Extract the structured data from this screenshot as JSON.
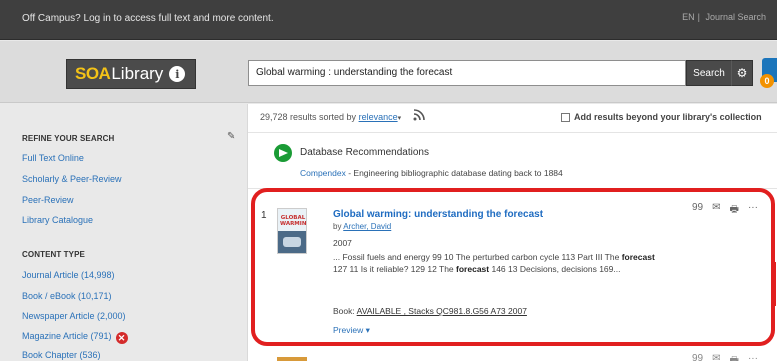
{
  "topbar": {
    "message": "Off Campus? Log in to access full text and more content.",
    "right_links": [
      "EN",
      "Journal Search"
    ]
  },
  "logo": {
    "part1": "SOA",
    "part2": "Library",
    "info_glyph": "i"
  },
  "search": {
    "value": "Global warming : understanding the forecast",
    "button_label": "Search",
    "gear_glyph": "⚙",
    "folder_count": "0"
  },
  "sidebar": {
    "refine_heading": "REFINE YOUR SEARCH",
    "refine_items": [
      "Full Text Online",
      "Scholarly & Peer-Review",
      "Peer-Review",
      "Library Catalogue"
    ],
    "content_type_heading": "CONTENT TYPE",
    "content_types": [
      "Journal Article (14,998)",
      "Book / eBook (10,171)",
      "Newspaper Article (2,000)",
      "Magazine Article (791)",
      "Book Chapter (536)"
    ]
  },
  "results_bar": {
    "summary_prefix": "29,728 results sorted by",
    "sort_label": "relevance",
    "add_beyond_label": "Add results beyond your library's collection"
  },
  "recommendations": {
    "title": "Database Recommendations",
    "database": "Compendex",
    "description": "- Engineering bibliographic database dating back to 1884"
  },
  "result": {
    "number": "1",
    "cover_text": "GLOBAL WARMING",
    "title": "Global warming: understanding the forecast",
    "author_prefix": "by",
    "author": "Archer, David",
    "year": "2007",
    "snippet": {
      "part1": "... Fossil fuels and energy 99 10 The perturbed carbon cycle 113 Part III The ",
      "bold1": "forecast",
      "part2": " 127 11 Is it reliable? 129 12 The ",
      "bold2": "forecast",
      "part3": " 146 13 Decisions, decisions 169..."
    },
    "availability_prefix": "Book:",
    "availability": "AVAILABLE , Stacks QC981.8.G56 A73 2007",
    "preview_label": "Preview",
    "actions": [
      "99",
      "✉",
      "🖶",
      "···"
    ]
  },
  "colors": {
    "accent_blue": "#1f6cc1",
    "highlight_red": "#e11f1f",
    "topbar_bg": "#3f3f3f",
    "logo_yellow": "#f3c217"
  }
}
